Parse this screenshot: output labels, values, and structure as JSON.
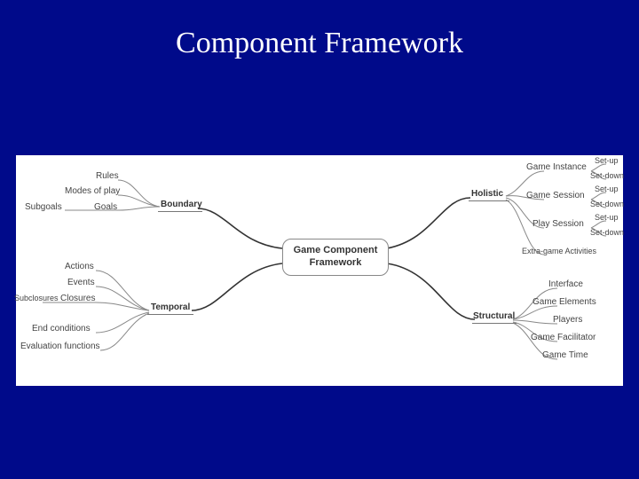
{
  "title": "Component Framework",
  "center": "Game Component\nFramework",
  "branches": {
    "boundary": {
      "label": "Boundary",
      "children": [
        "Rules",
        "Modes of play",
        "Subgoals",
        "Goals"
      ]
    },
    "temporal": {
      "label": "Temporal",
      "children": [
        "Actions",
        "Events",
        "Subclosures",
        "Closures",
        "End conditions",
        "Evaluation functions"
      ]
    },
    "holistic": {
      "label": "Holistic",
      "children": [
        {
          "label": "Game Instance",
          "children": [
            "Set-up",
            "Set-down"
          ]
        },
        {
          "label": "Game Session",
          "children": [
            "Set-up",
            "Set-down"
          ]
        },
        {
          "label": "Play Session",
          "children": [
            "Set-up",
            "Set-down"
          ]
        },
        {
          "label": "Extra-game Activities",
          "children": []
        }
      ]
    },
    "structural": {
      "label": "Structural",
      "children": [
        "Interface",
        "Game Elements",
        "Players",
        "Game Facilitator",
        "Game Time"
      ]
    }
  }
}
